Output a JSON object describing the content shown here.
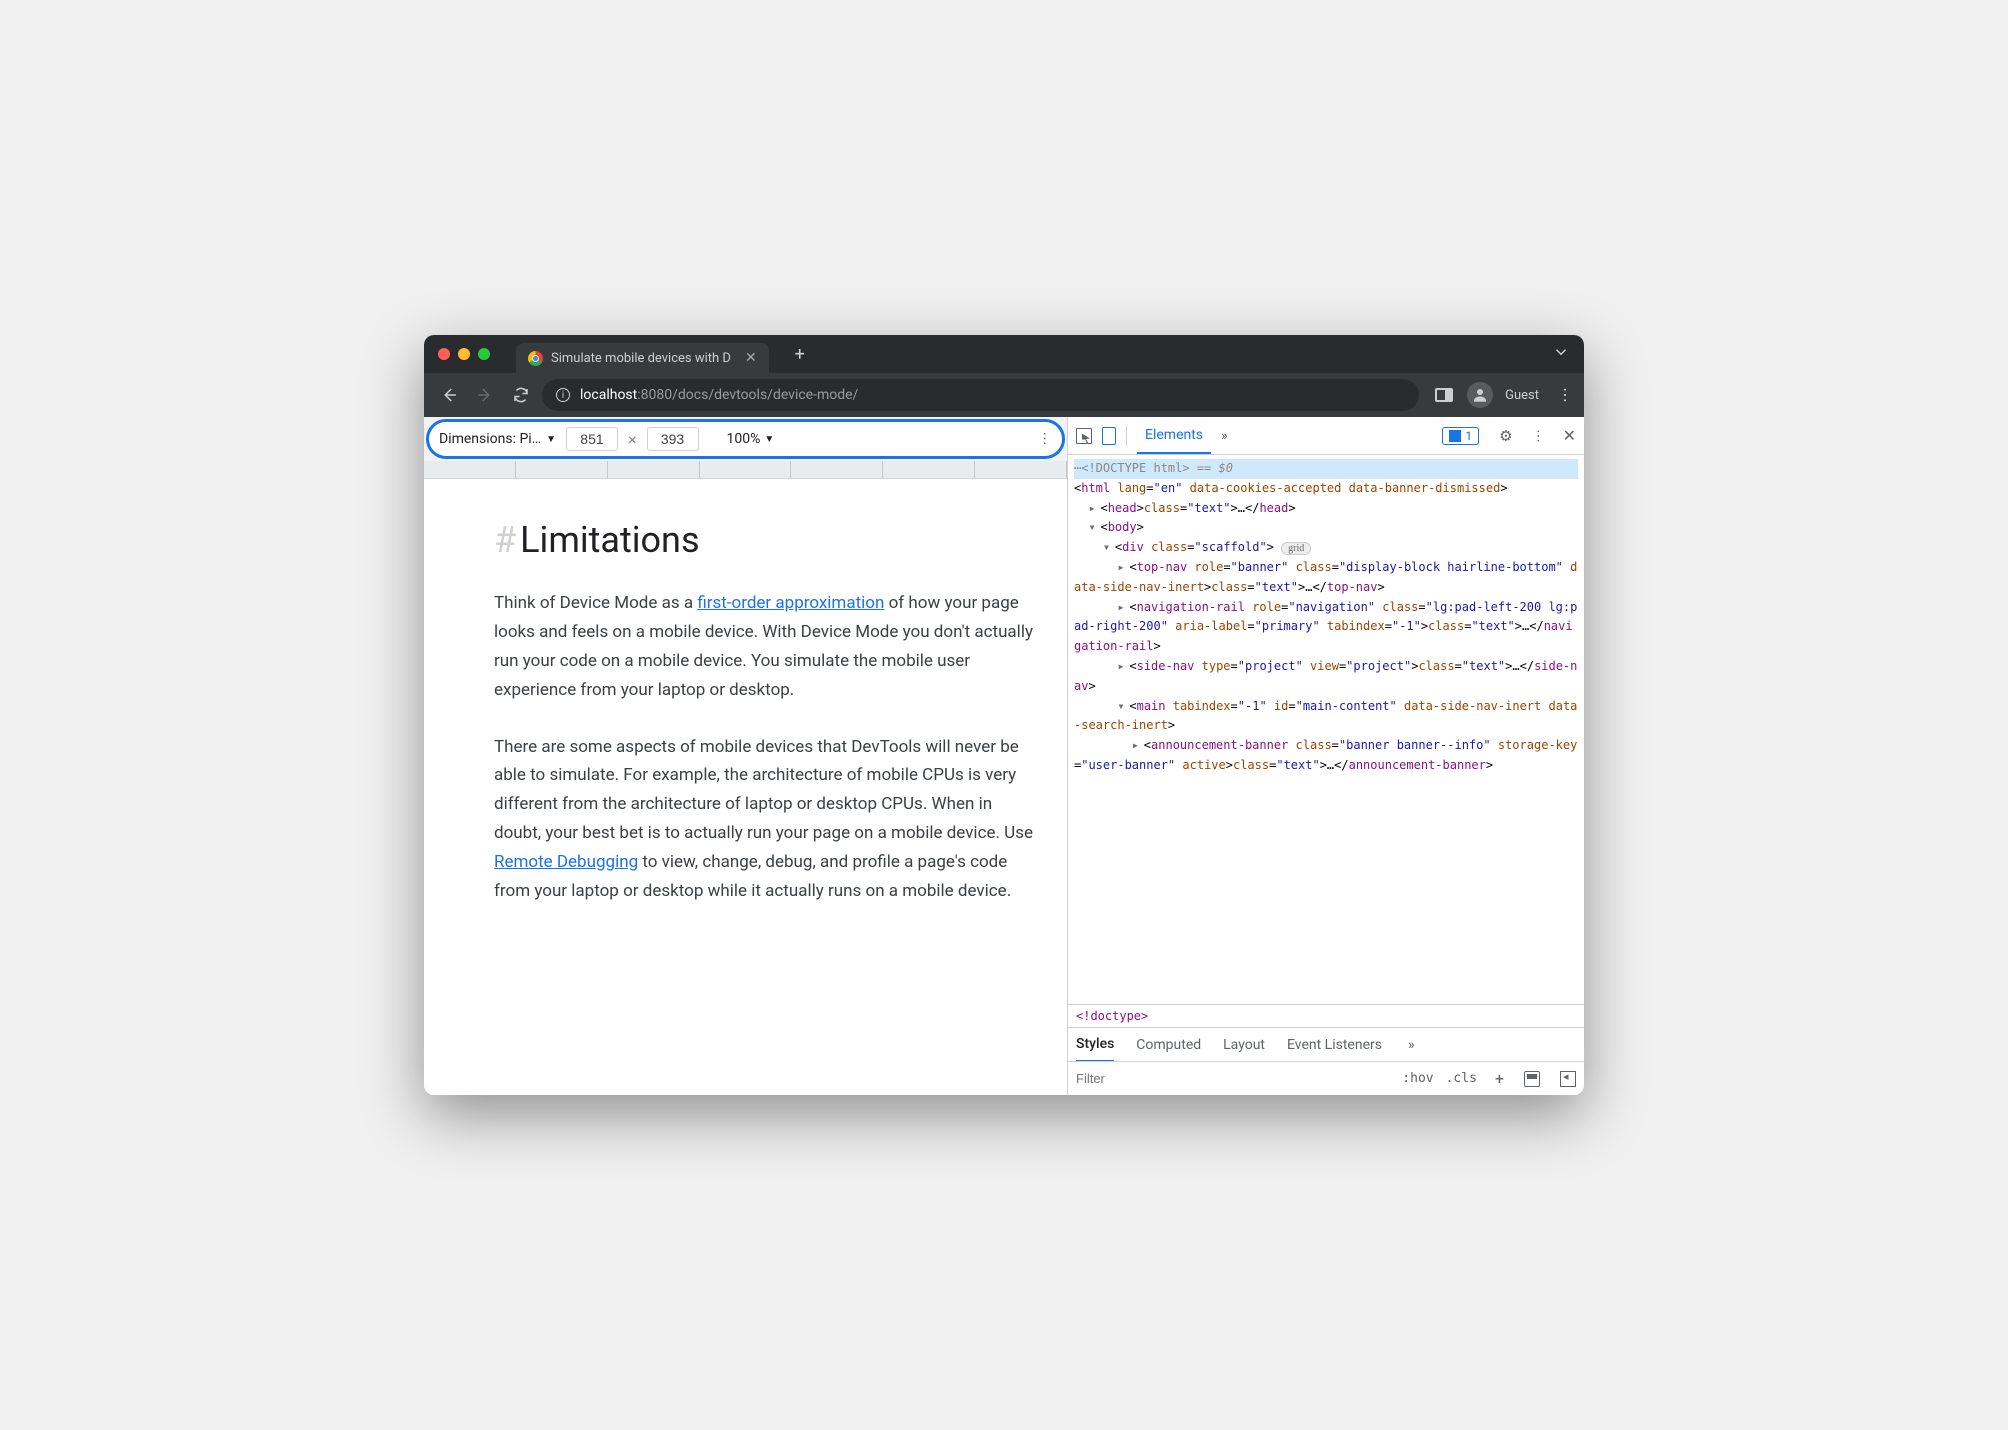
{
  "browser": {
    "tab_title": "Simulate mobile devices with D",
    "url_host": "localhost",
    "url_port": ":8080",
    "url_path": "/docs/devtools/device-mode/",
    "profile": "Guest"
  },
  "device_toolbar": {
    "dimensions_label": "Dimensions: Pi…",
    "width": "851",
    "height": "393",
    "zoom": "100%"
  },
  "page": {
    "heading": "Limitations",
    "p1_a": "Think of Device Mode as a ",
    "p1_link": "first-order approximation",
    "p1_b": " of how your page looks and feels on a mobile device. With Device Mode you don't actually run your code on a mobile device. You simulate the mobile user experience from your laptop or desktop.",
    "p2_a": "There are some aspects of mobile devices that DevTools will never be able to simulate. For example, the architecture of mobile CPUs is very different from the architecture of laptop or desktop CPUs. When in doubt, your best bet is to actually run your page on a mobile device. Use ",
    "p2_link": "Remote Debugging",
    "p2_b": " to view, change, debug, and profile a page's code from your laptop or desktop while it actually runs on a mobile device."
  },
  "devtools": {
    "tab": "Elements",
    "issues_count": "1",
    "styles_tabs": {
      "styles": "Styles",
      "computed": "Computed",
      "layout": "Layout",
      "listeners": "Event Listeners"
    },
    "filter_placeholder": "Filter",
    "hov": ":hov",
    "cls": ".cls",
    "breadcrumb": "<!doctype>",
    "dom": {
      "doctype": "<!DOCTYPE html>",
      "sel0": " == $0",
      "html_open": "<html lang=\"en\" data-cookies-accepted data-banner-dismissed>",
      "head": "<head>…</head>",
      "body": "<body>",
      "div_scaffold": "<div class=\"scaffold\">",
      "grid_pill": "grid",
      "topnav": "<top-nav role=\"banner\" class=\"display-block hairline-bottom\" data-side-nav-inert>…</top-nav>",
      "navrail": "<navigation-rail role=\"navigation\" class=\"lg:pad-left-200 lg:pad-right-200\" aria-label=\"primary\" tabindex=\"-1\">…</navigation-rail>",
      "sidenav": "<side-nav type=\"project\" view=\"project\">…</side-nav>",
      "main": "<main tabindex=\"-1\" id=\"main-content\" data-side-nav-inert data-search-inert>",
      "banner": "<announcement-banner class=\"banner banner--info\" storage-key=\"user-banner\" active>…</announcement-banner>"
    }
  }
}
